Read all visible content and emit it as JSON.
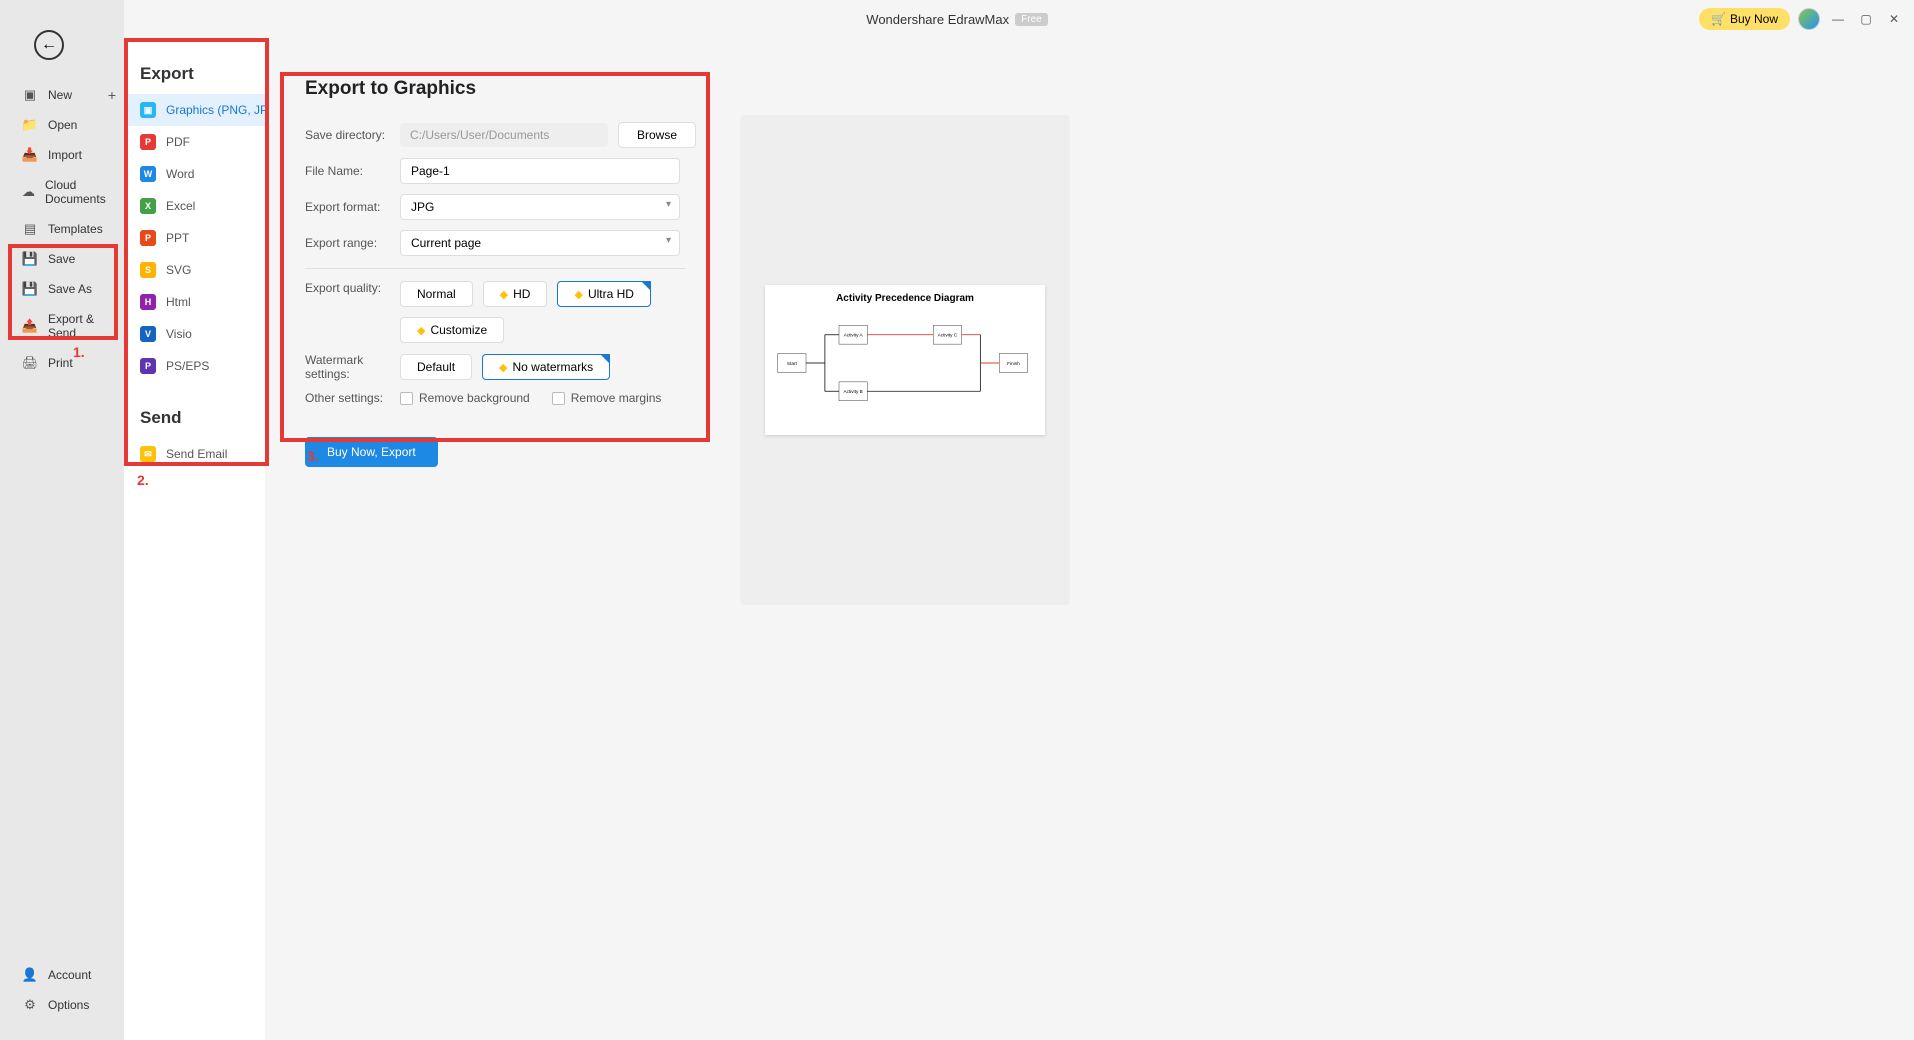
{
  "titlebar": {
    "title": "Wondershare EdrawMax",
    "badge": "Free",
    "buy_now": "Buy Now"
  },
  "sidebar": {
    "new": "New",
    "open": "Open",
    "import": "Import",
    "cloud": "Cloud Documents",
    "templates": "Templates",
    "save": "Save",
    "save_as": "Save As",
    "export_send": "Export & Send",
    "print": "Print",
    "account": "Account",
    "options": "Options"
  },
  "export_col": {
    "heading_export": "Export",
    "heading_send": "Send",
    "items": {
      "graphics": "Graphics (PNG, JPG e...",
      "pdf": "PDF",
      "word": "Word",
      "excel": "Excel",
      "ppt": "PPT",
      "svg": "SVG",
      "html": "Html",
      "visio": "Visio",
      "pseps": "PS/EPS",
      "send_email": "Send Email"
    }
  },
  "main": {
    "title": "Export to Graphics",
    "labels": {
      "save_dir": "Save directory:",
      "file_name": "File Name:",
      "export_format": "Export format:",
      "export_range": "Export range:",
      "export_quality": "Export quality:",
      "watermark": "Watermark settings:",
      "other": "Other settings:"
    },
    "values": {
      "save_dir": "C:/Users/User/Documents",
      "file_name": "Page-1",
      "export_format": "JPG",
      "export_range": "Current page"
    },
    "quality": {
      "normal": "Normal",
      "hd": "HD",
      "ultra_hd": "Ultra HD",
      "customize": "Customize"
    },
    "watermark": {
      "default": "Default",
      "none": "No watermarks"
    },
    "checkboxes": {
      "remove_bg": "Remove background",
      "remove_margins": "Remove margins"
    },
    "browse": "Browse",
    "export_btn": "Buy Now, Export"
  },
  "preview": {
    "title": "Activity Precedence Diagram"
  },
  "annotations": {
    "one": "1.",
    "two": "2.",
    "three": "3."
  }
}
